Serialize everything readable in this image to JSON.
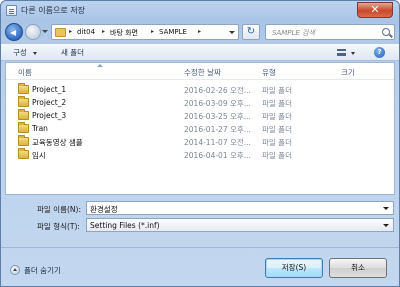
{
  "window": {
    "title": "다른 이름으로 저장",
    "close_label": "✕"
  },
  "nav": {
    "breadcrumbs": [
      "dit04",
      "바탕 화면",
      "SAMPLE"
    ],
    "search_placeholder": "SAMPLE 검색",
    "refresh_label": "↻"
  },
  "toolbar": {
    "organize_label": "구성",
    "new_folder_label": "새 폴더",
    "help_label": "?"
  },
  "columns": {
    "name": "이름",
    "date": "수정한 날짜",
    "type": "유형",
    "size": "크기"
  },
  "files": [
    {
      "name": "Project_1",
      "date": "2016-02-26 오전...",
      "type": "파일 폴더"
    },
    {
      "name": "Project_2",
      "date": "2016-03-09 오후...",
      "type": "파일 폴더"
    },
    {
      "name": "Project_3",
      "date": "2016-03-25 오후...",
      "type": "파일 폴더"
    },
    {
      "name": "Tran",
      "date": "2016-01-27 오후...",
      "type": "파일 폴더"
    },
    {
      "name": "교육동영상 샘플",
      "date": "2014-11-07 오전...",
      "type": "파일 폴더"
    },
    {
      "name": "임시",
      "date": "2016-04-01 오후...",
      "type": "파일 폴더"
    }
  ],
  "fields": {
    "filename_label": "파일 이름(N):",
    "filename_value": "환경설정",
    "filetype_label": "파일 형식(T):",
    "filetype_value": "Setting Files (*.inf)"
  },
  "footer": {
    "hide_folders_label": "폴더 숨기기",
    "save_label": "저장(S)",
    "cancel_label": "취소"
  },
  "colors": {
    "accent": "#3c7fb1",
    "folder": "#deb140",
    "frame": "#a9c4e6"
  }
}
